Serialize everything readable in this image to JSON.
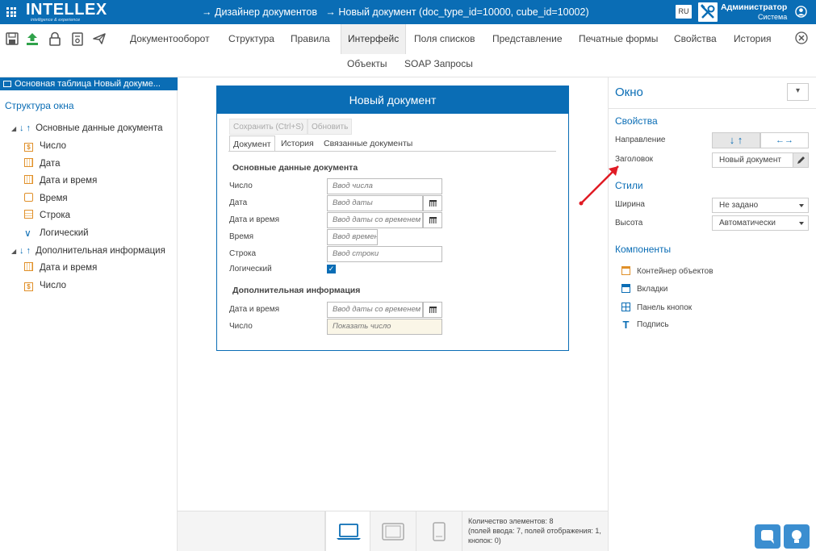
{
  "header": {
    "logo_text": "INTELLEX",
    "logo_subtext": "intelligence & experience",
    "breadcrumb": [
      "→ Дизайнер документов",
      "→ Новый документ (doc_type_id=10000, cube_id=10002)"
    ],
    "lang": "RU",
    "user_name": "Администратор",
    "user_role": "Система"
  },
  "toolbar": {
    "tabs": [
      "Документооборот",
      "Структура",
      "Правила",
      "Интерфейс",
      "Поля списков",
      "Представление",
      "Печатные формы",
      "Свойства",
      "История"
    ],
    "active_tab": "Интерфейс",
    "subtabs": [
      "Объекты",
      "SOAP Запросы"
    ]
  },
  "left": {
    "table_header": "Основная таблица Новый докуме...",
    "tree_title": "Структура окна",
    "group1": "Основные данные документа",
    "group1_items": [
      "Число",
      "Дата",
      "Дата и время",
      "Время",
      "Строка",
      "Логический"
    ],
    "group2": "Дополнительная информация",
    "group2_items": [
      "Дата и время",
      "Число"
    ]
  },
  "form": {
    "title": "Новый документ",
    "save_btn": "Сохранить (Ctrl+S)",
    "refresh_btn": "Обновить",
    "tabs": [
      "Документ",
      "История",
      "Связанные документы"
    ],
    "section1": "Основные данные документа",
    "fields1": [
      {
        "label": "Число",
        "placeholder": "Ввод числа"
      },
      {
        "label": "Дата",
        "placeholder": "Ввод даты"
      },
      {
        "label": "Дата и время",
        "placeholder": "Ввод даты со временем"
      },
      {
        "label": "Время",
        "placeholder": "Ввод времени"
      },
      {
        "label": "Строка",
        "placeholder": "Ввод строки"
      },
      {
        "label": "Логический",
        "placeholder": ""
      }
    ],
    "section2": "Дополнительная информация",
    "fields2": [
      {
        "label": "Дата и время",
        "placeholder": "Ввод даты со временем"
      },
      {
        "label": "Число",
        "placeholder": "Показать число"
      }
    ]
  },
  "bottom": {
    "count_line1": "Количество элементов: 8",
    "count_line2": "(полей ввода: 7, полей отображения: 1, кнопок: 0)"
  },
  "right": {
    "title": "Окно",
    "props_title": "Свойства",
    "direction_label": "Направление",
    "direction_vertical": "↓ ↑",
    "direction_horizontal": "←→",
    "caption_label": "Заголовок",
    "caption_value": "Новый документ",
    "styles_title": "Стили",
    "width_label": "Ширина",
    "width_value": "Не задано",
    "height_label": "Высота",
    "height_value": "Автоматически",
    "components_title": "Компоненты",
    "components": [
      "Контейнер объектов",
      "Вкладки",
      "Панель кнопок",
      "Подпись"
    ]
  },
  "colors": {
    "primary": "#0a6db5",
    "accent_orange": "#e0902a",
    "annotation_red": "#e01b24"
  }
}
